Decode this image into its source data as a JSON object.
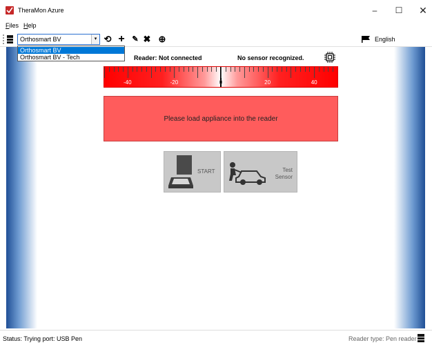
{
  "window": {
    "title": "TheraMon Azure",
    "minimize_glyph": "–",
    "maximize_glyph": "☐",
    "close_glyph": "✕"
  },
  "menu": {
    "files_accel": "F",
    "files_rest": "iles",
    "help_accel": "H",
    "help_rest": "elp"
  },
  "toolbar": {
    "selected_profile": "Orthosmart BV",
    "combo_arrow": "▾",
    "refresh_glyph": "⟲",
    "add_glyph": "+",
    "edit_glyph": "✎",
    "delete_glyph": "✖",
    "globe_glyph": "⊕",
    "language": "English"
  },
  "dropdown": {
    "options": [
      "Orthosmart BV",
      "Orthosmart BV - Tech"
    ],
    "highlighted_index": 0
  },
  "status_area": {
    "reader": "Reader: Not connected",
    "sensor": "No sensor recognized."
  },
  "gauge": {
    "labels": [
      "-40",
      "-20",
      "0",
      "20",
      "40"
    ],
    "min": -50,
    "max": 50,
    "value": 0
  },
  "message": "Please load appliance into the reader",
  "buttons": {
    "start": "START",
    "test_line1": "Test",
    "test_line2": "Sensor"
  },
  "statusbar": {
    "left": "Status: Trying port: USB Pen",
    "right": "Reader type: Pen reader"
  },
  "colors": {
    "accent": "#0078d7",
    "alert": "#ff5c5c",
    "frame_blue": "#1f4f96"
  }
}
